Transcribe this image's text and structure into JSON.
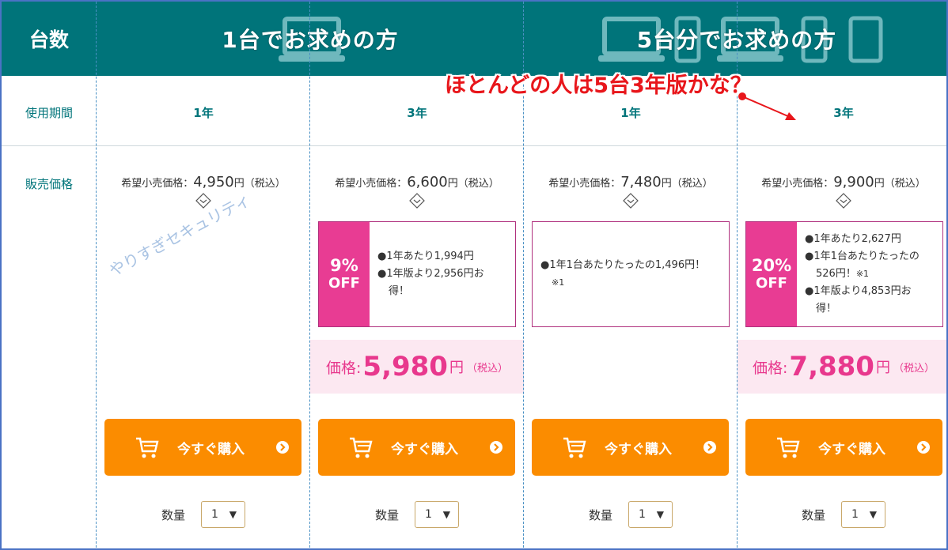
{
  "header": {
    "count_label": "台数",
    "group_single": "1台でお求めの方",
    "group_five": "5台分でお求めの方"
  },
  "annotation": "ほとんどの人は5台3年版かな？",
  "rows": {
    "period_label": "使用期間",
    "price_label": "販売価格"
  },
  "watermark": "やりすぎセキュリティ",
  "columns": [
    {
      "period": "1年",
      "msrp_label": "希望小売価格：",
      "msrp_value": "4,950",
      "msrp_unit": "円",
      "msrp_tax": "（税込）",
      "buy_label": "今すぐ購入",
      "qty_label": "数量",
      "qty_value": "1"
    },
    {
      "period": "3年",
      "msrp_label": "希望小売価格：",
      "msrp_value": "6,600",
      "msrp_unit": "円",
      "msrp_tax": "（税込）",
      "discount_pct": "9%",
      "discount_off": "OFF",
      "benefits": [
        "●1年あたり1,994円",
        "●1年版より2,956円お",
        "得！"
      ],
      "price_label": "価格:",
      "price_value": "5,980",
      "price_unit": "円",
      "price_tax": "（税込）",
      "buy_label": "今すぐ購入",
      "qty_label": "数量",
      "qty_value": "1"
    },
    {
      "period": "1年",
      "msrp_label": "希望小売価格：",
      "msrp_value": "7,480",
      "msrp_unit": "円",
      "msrp_tax": "（税込）",
      "benefits": [
        "●1年1台あたりたったの1,496円！"
      ],
      "benefit_note": "※1",
      "buy_label": "今すぐ購入",
      "qty_label": "数量",
      "qty_value": "1"
    },
    {
      "period": "3年",
      "msrp_label": "希望小売価格：",
      "msrp_value": "9,900",
      "msrp_unit": "円",
      "msrp_tax": "（税込）",
      "discount_pct": "20%",
      "discount_off": "OFF",
      "benefits": [
        "●1年あたり2,627円",
        "●1年1台あたりたったの",
        "526円！",
        "●1年版より4,853円お",
        "得！"
      ],
      "benefit_note": "※1",
      "price_label": "価格:",
      "price_value": "7,880",
      "price_unit": "円",
      "price_tax": "（税込）",
      "buy_label": "今すぐ購入",
      "qty_label": "数量",
      "qty_value": "1"
    }
  ],
  "colors": {
    "header_bg": "#00747a",
    "accent_pink": "#e83c93",
    "buy_orange": "#fb8c00",
    "annotation_red": "#e8161b"
  }
}
